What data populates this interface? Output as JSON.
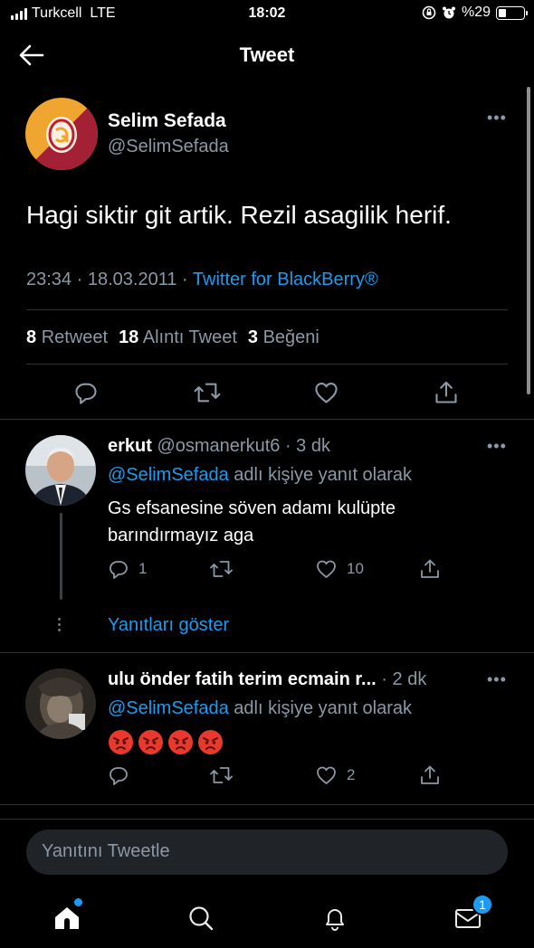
{
  "status_bar": {
    "carrier": "Turkcell",
    "network": "LTE",
    "time": "18:02",
    "battery": "%29"
  },
  "header": {
    "title": "Tweet"
  },
  "main_tweet": {
    "author_name": "Selim Sefada",
    "author_handle": "@SelimSefada",
    "text": "Hagi siktir git artik. Rezil asagilik herif.",
    "time": "23:34",
    "date": "18.03.2011",
    "separator": "·",
    "source": "Twitter for BlackBerry®",
    "stats": {
      "retweets_count": "8",
      "retweets_label": "Retweet",
      "quotes_count": "18",
      "quotes_label": "Alıntı Tweet",
      "likes_count": "3",
      "likes_label": "Beğeni"
    }
  },
  "replies": [
    {
      "name": "erkut",
      "handle": "@osmanerkut6",
      "time": "· 3 dk",
      "replying_mention": "@SelimSefada",
      "replying_text": "adlı kişiye yanıt olarak",
      "text_line1": "Gs efsanesine söven adamı kulüpte",
      "text_line2": "barındırmayız aga",
      "reply_count": "1",
      "retweet_count": "",
      "like_count": "10"
    },
    {
      "name": "ulu önder fatih terim ecmain r...",
      "handle": "",
      "time": "· 2 dk",
      "replying_mention": "@SelimSefada",
      "replying_text": "adlı kişiye yanıt olarak",
      "emoji": [
        "angry-face",
        "angry-face",
        "angry-face",
        "angry-face"
      ],
      "reply_count": "",
      "retweet_count": "",
      "like_count": "2"
    }
  ],
  "show_replies_label": "Yanıtları göster",
  "compose": {
    "placeholder": "Yanıtını Tweetle"
  },
  "tab_bar": {
    "home_icon": "home-icon",
    "search_icon": "search-icon",
    "notifications_icon": "bell-icon",
    "messages_icon": "mail-icon",
    "messages_badge": "1"
  },
  "colors": {
    "accent": "#1d9bf0",
    "background": "#000000",
    "secondary_text": "#8b98a5",
    "divider": "#2f3336"
  }
}
